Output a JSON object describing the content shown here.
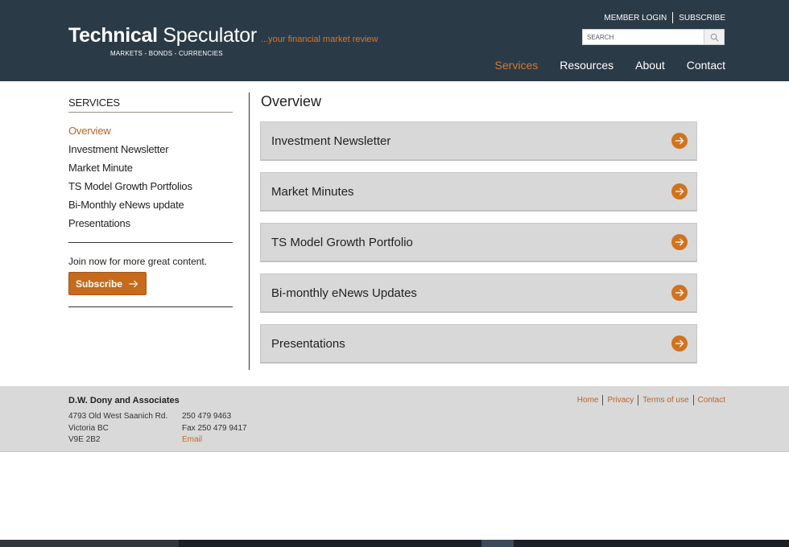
{
  "header": {
    "logo_bold": "Technical",
    "logo_thin": " Speculator",
    "tagline": "...your financial market review",
    "subtag": "MARKETS - BONDS - CURRENCIES",
    "top_links": [
      "MEMBER LOGIN",
      "SUBSCRIBE"
    ],
    "search_placeholder": "SEARCH",
    "nav": [
      {
        "label": "Services",
        "active": true
      },
      {
        "label": "Resources",
        "active": false
      },
      {
        "label": "About",
        "active": false
      },
      {
        "label": "Contact",
        "active": false
      }
    ]
  },
  "sidebar": {
    "heading": "SERVICES",
    "items": [
      "Overview",
      "Investment Newsletter",
      "Market Minute",
      "TS Model Growth Portfolios",
      "Bi-Monthly eNews update",
      "Presentations"
    ],
    "join_text": "Join now for more great content.",
    "subscribe_label": "Subscribe"
  },
  "main": {
    "title": "Overview",
    "cards": [
      "Investment Newsletter",
      "Market Minutes",
      "TS Model Growth Portfolio",
      "Bi-monthly eNews Updates",
      "Presentations"
    ]
  },
  "footer": {
    "company": "D.W. Dony and Associates",
    "address": [
      "4793 Old West Saanich Rd.",
      "Victoria BC",
      "V9E 2B2"
    ],
    "phone": "250 479 9463",
    "fax": "Fax 250 479 9417",
    "email": "Email",
    "links": [
      "Home",
      "Privacy",
      "Terms of use",
      "Contact"
    ]
  },
  "colors": {
    "header_bg": "#2b3a47",
    "accent": "#d8782a",
    "card_bg": "#d8d8d8",
    "footer_bg": "#d9d9d9"
  }
}
